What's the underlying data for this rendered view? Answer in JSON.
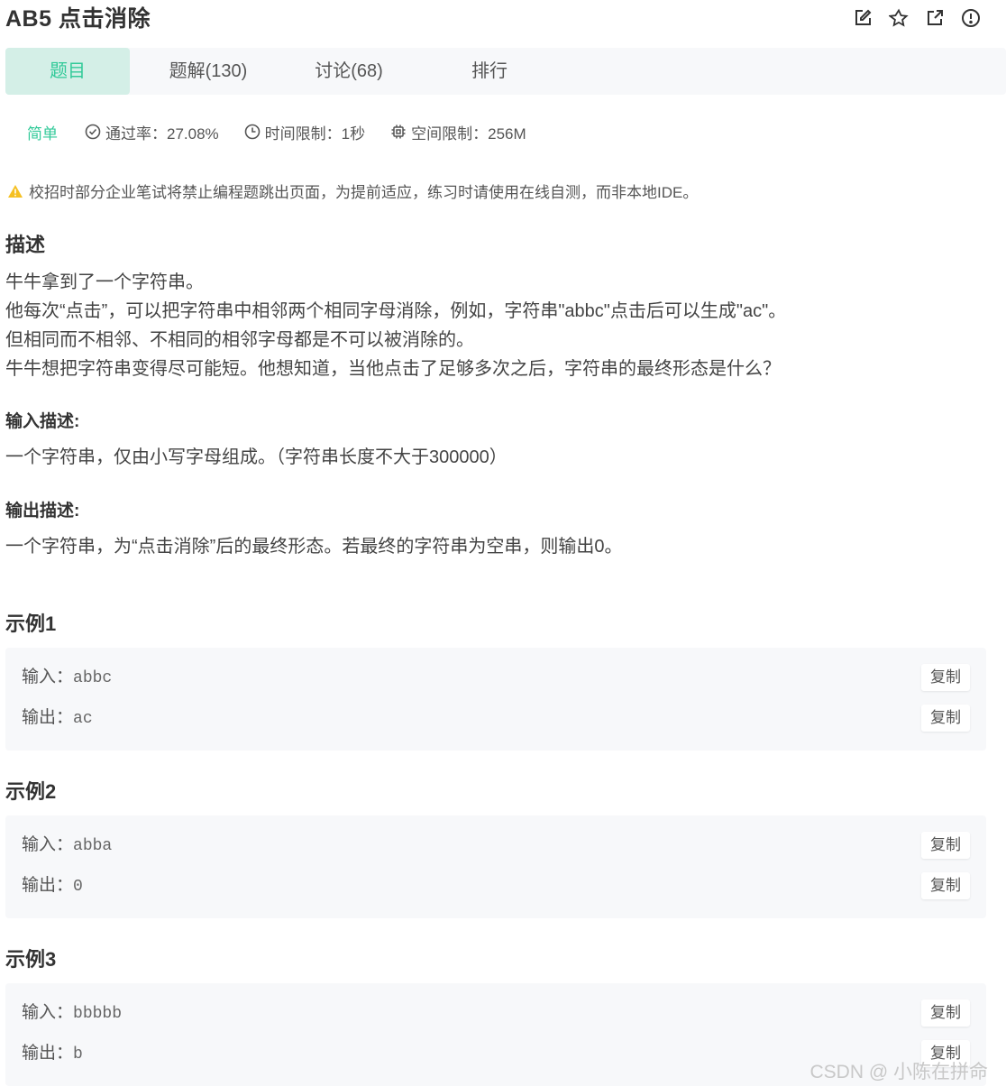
{
  "header": {
    "title": "AB5  点击消除",
    "icons": [
      "edit-icon",
      "star-icon",
      "share-icon",
      "report-icon"
    ]
  },
  "tabs": [
    {
      "label": "题目",
      "active": true
    },
    {
      "label": "题解(130)",
      "active": false
    },
    {
      "label": "讨论(68)",
      "active": false
    },
    {
      "label": "排行",
      "active": false
    }
  ],
  "meta": {
    "difficulty": "简单",
    "pass_rate": "通过率：27.08%",
    "time_limit": "时间限制：1秒",
    "space_limit": "空间限制：256M"
  },
  "notice": "校招时部分企业笔试将禁止编程题跳出页面，为提前适应，练习时请使用在线自测，而非本地IDE。",
  "description": {
    "heading": "描述",
    "lines": [
      "牛牛拿到了一个字符串。",
      "他每次“点击”，可以把字符串中相邻两个相同字母消除，例如，字符串\"abbc\"点击后可以生成\"ac\"。",
      "但相同而不相邻、不相同的相邻字母都是不可以被消除的。",
      "牛牛想把字符串变得尽可能短。他想知道，当他点击了足够多次之后，字符串的最终形态是什么？"
    ]
  },
  "input_desc": {
    "heading": "输入描述:",
    "text": "一个字符串，仅由小写字母组成。（字符串长度不大于300000）"
  },
  "output_desc": {
    "heading": "输出描述:",
    "text": "一个字符串，为“点击消除”后的最终形态。若最终的字符串为空串，则输出0。"
  },
  "examples": [
    {
      "title": "示例1",
      "input_label": "输入：",
      "input": "abbc",
      "output_label": "输出：",
      "output": "ac",
      "copy_label": "复制"
    },
    {
      "title": "示例2",
      "input_label": "输入：",
      "input": "abba",
      "output_label": "输出：",
      "output": "0",
      "copy_label": "复制"
    },
    {
      "title": "示例3",
      "input_label": "输入：",
      "input": "bbbbb",
      "output_label": "输出：",
      "output": "b",
      "copy_label": "复制"
    }
  ],
  "watermark": "CSDN @ 小陈在拼命",
  "colors": {
    "accent": "#32ca99",
    "tab_active_bg": "#d4efe7",
    "warning": "#f5c022"
  }
}
